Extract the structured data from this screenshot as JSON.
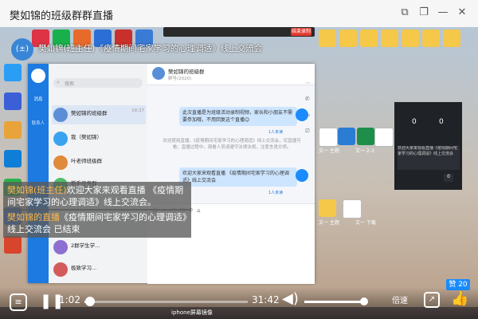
{
  "window": {
    "title": "樊如锦的班级群群直播",
    "buttons": [
      "restore-icon",
      "copy-icon",
      "minimize-icon",
      "close-icon"
    ]
  },
  "live": {
    "avatar_text": "(±)",
    "headline": "樊如锦(班主任)《疫情期间宅家学习的心理调适》线上交流会"
  },
  "recorder": {
    "stop_label": "结束录制"
  },
  "qq": {
    "search_placeholder": "搜索",
    "nav_labels": [
      "消息",
      "联系人"
    ],
    "conversations": [
      {
        "name": "樊如锦的班级群",
        "time": "18:27",
        "preview": "",
        "color": "#5a8fd8"
      },
      {
        "name": "我（樊如锦）",
        "time": "",
        "preview": "",
        "color": "#3aa3f0"
      },
      {
        "name": "叶老师班级群",
        "time": "",
        "preview": "",
        "color": "#e08a3c"
      },
      {
        "name": "新手任务群",
        "time": "",
        "preview": "",
        "color": "#4cbf6a"
      },
      {
        "name": "2群学生学...",
        "time": "",
        "preview": "",
        "color": "#8d6fd1"
      },
      {
        "name": "极致学习...",
        "time": "",
        "preview": "",
        "color": "#d45b5b"
      }
    ],
    "chat_title": "樊如锦的班级群",
    "chat_subtitle": "群号(2020)",
    "messages": [
      {
        "text": "此次直播是为班级活动录制视频，家长和小朋友不需要参加哦，不用回复这个直播😊",
        "sender": "1人未读"
      },
      {
        "text": "欢迎大家来观看直播 《疫情期间宅家学习的心理调适》线上交流会",
        "sender": "1人未读"
      }
    ],
    "notice": "欢迎使用直播，《疫情期间宅家学习的心理调适》线上交流会，仅直播可看；直播过程中，观看人员请遵守法律法规，注意言语文明。"
  },
  "side_panel": {
    "counts": [
      "0",
      "0"
    ],
    "badges": [
      "0"
    ],
    "message": "欢迎大家来观看直播《疫情期间宅家学习的心理调适》线上交流会"
  },
  "overlay": {
    "msg1_who": "樊如锦(班主任)",
    "msg1_text": "欢迎大家来观看直播 《疫情期间宅家学习的心理调适》线上交流会。",
    "msg2_who": "樊如锦的直播",
    "msg2_text": "《疫情期间宅家学习的心理调适》线上交流会 已结束"
  },
  "player": {
    "current_time": "1:02",
    "total_time": "31:42",
    "progress_fraction": 0.033,
    "volume_fraction": 1.0,
    "speed_label": "倍速",
    "like_badge": "赞 20"
  },
  "desktop": {
    "left_icons": [
      "qq-icon",
      "browser-icon",
      "app-icon",
      "app-icon-2",
      "edge-icon",
      "app-icon-3",
      "app-icon-4",
      "app-icon-5",
      "app-icon-6",
      "app-icon-7"
    ],
    "top_icon_labels": [
      "",
      "",
      "",
      "",
      "",
      "",
      "",
      "",
      "",
      "",
      "",
      "",
      "",
      ""
    ],
    "file_labels": [
      "文一 主题",
      "文一 2-3",
      "文一 主题",
      "文一 下载"
    ]
  },
  "taskbar": {
    "items": [
      "iphone屏幕镜像"
    ]
  }
}
